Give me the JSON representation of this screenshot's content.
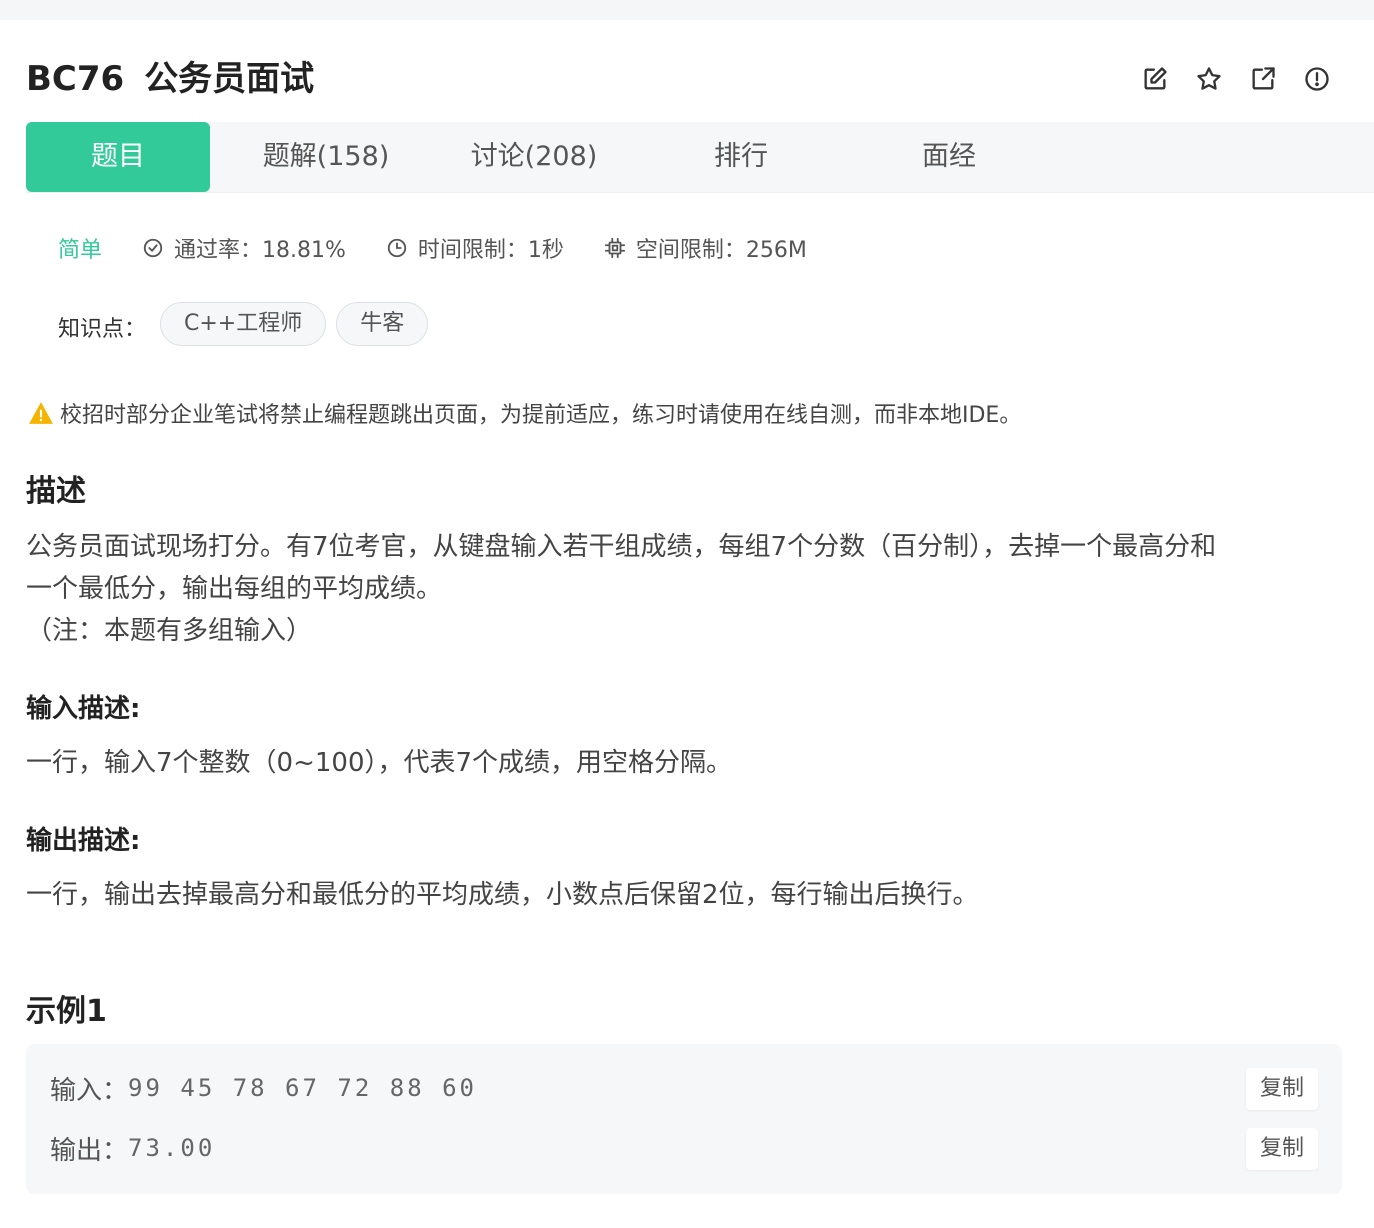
{
  "problem": {
    "code": "BC76",
    "title": "公务员面试"
  },
  "actions": [
    {
      "name": "edit-icon"
    },
    {
      "name": "star-icon"
    },
    {
      "name": "share-icon"
    },
    {
      "name": "report-icon"
    }
  ],
  "tabs": [
    {
      "label": "题目",
      "active": true
    },
    {
      "label": "题解(158)",
      "active": false
    },
    {
      "label": "讨论(208)",
      "active": false
    },
    {
      "label": "排行",
      "active": false
    },
    {
      "label": "面经",
      "active": false
    }
  ],
  "meta": {
    "level": "简单",
    "pass_rate": "通过率：18.81%",
    "time_limit": "时间限制：1秒",
    "space_limit": "空间限制：256M"
  },
  "knowledge": {
    "label": "知识点：",
    "tags": [
      "C++工程师",
      "牛客"
    ]
  },
  "notice": "校招时部分企业笔试将禁止编程题跳出页面，为提前适应，练习时请使用在线自测，而非本地IDE。",
  "description": {
    "heading": "描述",
    "lines": [
      "公务员面试现场打分。有7位考官，从键盘输入若干组成绩，每组7个分数（百分制），去掉一个最高分和",
      "一个最低分，输出每组的平均成绩。",
      "（注：本题有多组输入）"
    ]
  },
  "input_desc": {
    "heading": "输入描述:",
    "text": "一行，输入7个整数（0~100），代表7个成绩，用空格分隔。"
  },
  "output_desc": {
    "heading": "输出描述:",
    "text": "一行，输出去掉最高分和最低分的平均成绩，小数点后保留2位，每行输出后换行。"
  },
  "example": {
    "heading": "示例1",
    "input_label": "输入：",
    "input_value": "99 45 78 67 72 88 60",
    "output_label": "输出：",
    "output_value": "73.00",
    "copy_label": "复制"
  },
  "colors": {
    "accent": "#32ca99",
    "warning": "#f5b400"
  }
}
